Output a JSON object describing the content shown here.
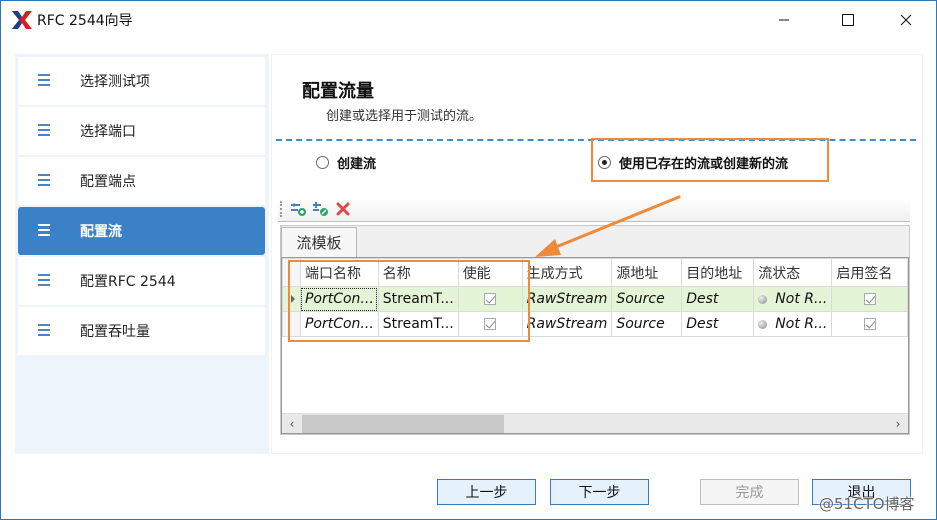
{
  "window": {
    "title": "RFC 2544向导",
    "controls": {
      "minimize": "minimize",
      "maximize": "maximize",
      "close": "close"
    }
  },
  "sidebar": {
    "items": [
      {
        "label": "选择测试项",
        "icon": "list-icon",
        "active": false
      },
      {
        "label": "选择端口",
        "icon": "list-icon",
        "active": false
      },
      {
        "label": "配置端点",
        "icon": "list-icon",
        "active": false
      },
      {
        "label": "配置流",
        "icon": "list-icon",
        "active": true
      },
      {
        "label": "配置RFC 2544",
        "icon": "list-icon",
        "active": false
      },
      {
        "label": "配置吞吐量",
        "icon": "list-icon",
        "active": false
      }
    ]
  },
  "main": {
    "title": "配置流量",
    "subtitle": "创建或选择用于测试的流。",
    "options": [
      {
        "label": "创建流",
        "checked": false
      },
      {
        "label": "使用已存在的流或创建新的流",
        "checked": true
      }
    ],
    "toolbar": {
      "buttons": [
        "add-stream-icon",
        "edit-stream-icon",
        "delete-icon"
      ]
    },
    "tab": {
      "label": "流模板"
    },
    "grid": {
      "columns": [
        "端口名称",
        "名称",
        "使能",
        "生成方式",
        "源地址",
        "目的地址",
        "流状态",
        "启用签名"
      ],
      "rows": [
        {
          "port": "PortCon...",
          "name": "StreamT...",
          "enabled": true,
          "mode": "RawStream",
          "src": "Source",
          "dst": "Dest",
          "status": "Not R...",
          "signature": true,
          "selected": true
        },
        {
          "port": "PortCon...",
          "name": "StreamT...",
          "enabled": true,
          "mode": "RawStream",
          "src": "Source",
          "dst": "Dest",
          "status": "Not R...",
          "signature": true,
          "selected": false
        }
      ],
      "scroll_left": "‹",
      "scroll_right": "›"
    }
  },
  "footer": {
    "prev": "上一步",
    "next": "下一步",
    "finish": "完成",
    "exit": "退出"
  },
  "annotation": {
    "color": "#ef8a3a"
  },
  "watermark": "@51CTO博客"
}
